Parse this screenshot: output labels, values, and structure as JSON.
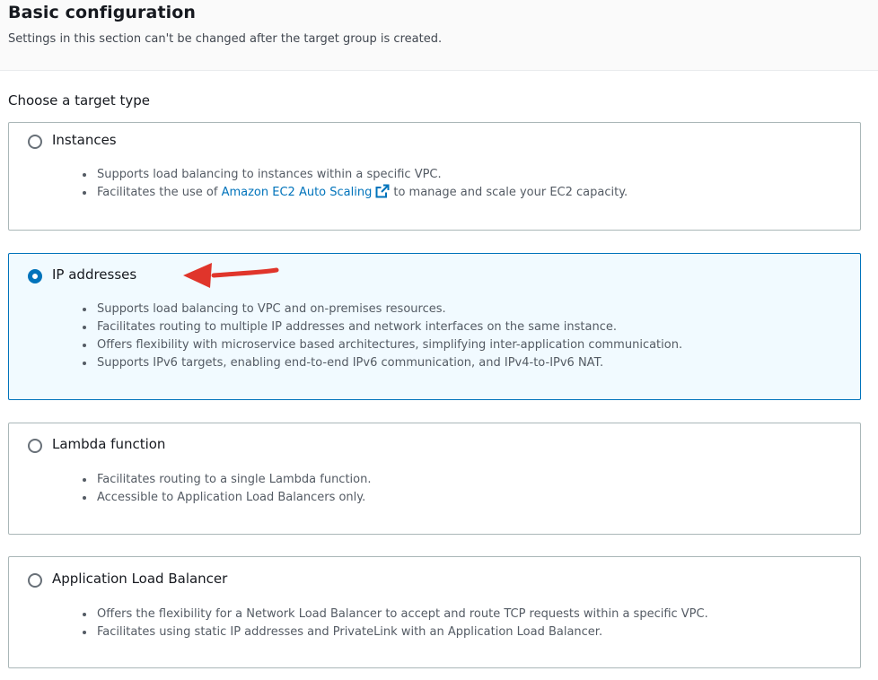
{
  "header": {
    "title": "Basic configuration",
    "subtitle": "Settings in this section can't be changed after the target group is created."
  },
  "target_type": {
    "label": "Choose a target type",
    "selected": "ip",
    "options": [
      {
        "id": "instances",
        "label": "Instances",
        "bullets": [
          "Supports load balancing to instances within a specific VPC.",
          "Facilitates the use of"
        ],
        "link_text": "Amazon EC2 Auto Scaling",
        "link_suffix": "to manage and scale your EC2 capacity."
      },
      {
        "id": "ip",
        "label": "IP addresses",
        "bullets": [
          "Supports load balancing to VPC and on-premises resources.",
          "Facilitates routing to multiple IP addresses and network interfaces on the same instance.",
          "Offers flexibility with microservice based architectures, simplifying inter-application communication.",
          "Supports IPv6 targets, enabling end-to-end IPv6 communication, and IPv4-to-IPv6 NAT."
        ]
      },
      {
        "id": "lambda",
        "label": "Lambda function",
        "bullets": [
          "Facilitates routing to a single Lambda function.",
          "Accessible to Application Load Balancers only."
        ]
      },
      {
        "id": "alb",
        "label": "Application Load Balancer",
        "bullets": [
          "Offers the flexibility for a Network Load Balancer to accept and route TCP requests within a specific VPC.",
          "Facilitates using static IP addresses and PrivateLink with an Application Load Balancer."
        ]
      }
    ]
  },
  "colors": {
    "accent": "#0073bb",
    "selected_bg": "#f1faff",
    "annotation_arrow": "#e0352b"
  },
  "icons": {
    "external_link": "external-link-icon",
    "annotation": "red-arrow-annotation"
  }
}
